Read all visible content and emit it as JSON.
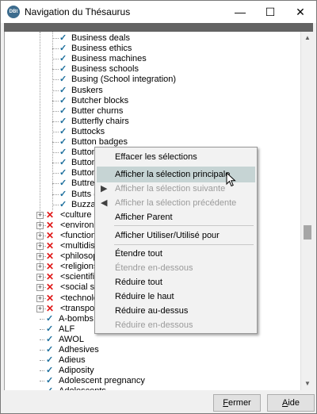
{
  "window": {
    "title": "Navigation du Thésaurus",
    "app_icon_text": "DBt",
    "controls": {
      "minimize": "—",
      "maximize": "☐",
      "close": "✕"
    }
  },
  "tree": {
    "nested_items": [
      "Business deals",
      "Business ethics",
      "Business machines",
      "Business schools",
      "Busing (School integration)",
      "Buskers",
      "Butcher blocks",
      "Butter churns",
      "Butterfly chairs",
      "Buttocks",
      "Button badges",
      "Button",
      "Buttons",
      "Buttons",
      "Buttres",
      "Butts (",
      "Buzzard"
    ],
    "category_items": [
      "<culture ar",
      "<environme",
      "<functiona",
      "<multidiscip",
      "<philosoph",
      "<religions a",
      "<scientific c",
      "<social scie",
      "<technolog",
      "<transport"
    ],
    "top_items": [
      "A-bombs",
      "ALF",
      "AWOL",
      "Adhesives",
      "Adieus",
      "Adiposity",
      "Adolescent pregnancy",
      "Adolescents"
    ],
    "check_glyph": "✓",
    "cross_glyph": "✕",
    "expander_glyph": "+"
  },
  "context_menu": {
    "items": [
      {
        "label": "Effacer les sélections",
        "enabled": true
      },
      {
        "label": "Afficher la sélection principale",
        "enabled": true,
        "highlighted": true
      },
      {
        "label": "Afficher la sélection suivante",
        "enabled": false,
        "icon": "▶"
      },
      {
        "label": "Afficher la sélection précédente",
        "enabled": false,
        "icon": "◀"
      },
      {
        "label": "Afficher Parent",
        "enabled": true
      },
      {
        "label": "Afficher Utiliser/Utilisé pour",
        "enabled": true
      },
      {
        "label": "Étendre tout",
        "enabled": true
      },
      {
        "label": "Étendre en-dessous",
        "enabled": false
      },
      {
        "label": "Réduire tout",
        "enabled": true
      },
      {
        "label": "Réduire le haut",
        "enabled": true
      },
      {
        "label": "Réduire au-dessus",
        "enabled": true
      },
      {
        "label": "Réduire en-dessous",
        "enabled": false
      }
    ]
  },
  "footer": {
    "close_label": "Fermer",
    "help_label": "Aide"
  },
  "scrollbar": {
    "up": "▲",
    "down": "▼"
  },
  "colors": {
    "check": "#1b6e9c",
    "cross": "#e01818",
    "menu_highlight": "#c6d4d4"
  }
}
